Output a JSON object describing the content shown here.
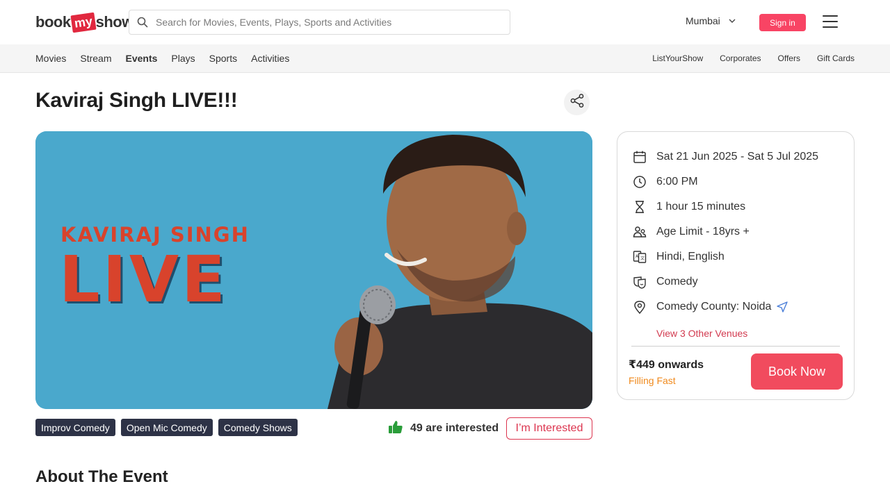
{
  "header": {
    "logo": {
      "part1": "book",
      "part2": "my",
      "part3": "show"
    },
    "search_placeholder": "Search for Movies, Events, Plays, Sports and Activities",
    "city": "Mumbai",
    "sign_in": "Sign in"
  },
  "subnav": {
    "left": [
      {
        "label": "Movies"
      },
      {
        "label": "Stream"
      },
      {
        "label": "Events"
      },
      {
        "label": "Plays"
      },
      {
        "label": "Sports"
      },
      {
        "label": "Activities"
      }
    ],
    "right": [
      {
        "label": "ListYourShow"
      },
      {
        "label": "Corporates"
      },
      {
        "label": "Offers"
      },
      {
        "label": "Gift Cards"
      }
    ]
  },
  "event": {
    "title": "Kaviraj Singh LIVE!!!",
    "banner_name": "KAVIRAJ SINGH",
    "banner_live": "LIVE",
    "tags": [
      "Improv Comedy",
      "Open Mic Comedy",
      "Comedy Shows"
    ],
    "interested_count": "49 are interested",
    "interested_button": "I’m Interested"
  },
  "details": {
    "date": "Sat 21 Jun 2025 - Sat 5 Jul 2025",
    "time": "6:00 PM",
    "duration": "1 hour 15 minutes",
    "age_limit": "Age Limit - 18yrs +",
    "languages": "Hindi, English",
    "genre": "Comedy",
    "venue": "Comedy County: Noida",
    "other_venues": "View 3 Other Venues",
    "price": "₹449 onwards",
    "availability": "Filling Fast",
    "book_button": "Book Now"
  },
  "about_heading": "About The Event",
  "colors": {
    "brand": "#f84464",
    "book_button": "#f14b5e",
    "tag_bg": "#2d3246",
    "banner_bg": "#4aa8cc",
    "filling_fast": "#f08a1d",
    "thumb": "#2a9d3a"
  },
  "icons": [
    "search-icon",
    "chevron-down-icon",
    "hamburger-menu-icon",
    "share-icon",
    "calendar-icon",
    "clock-icon",
    "hourglass-icon",
    "people-icon",
    "language-icon",
    "genre-masks-icon",
    "location-pin-icon",
    "navigate-arrow-icon",
    "thumbs-up-icon"
  ]
}
